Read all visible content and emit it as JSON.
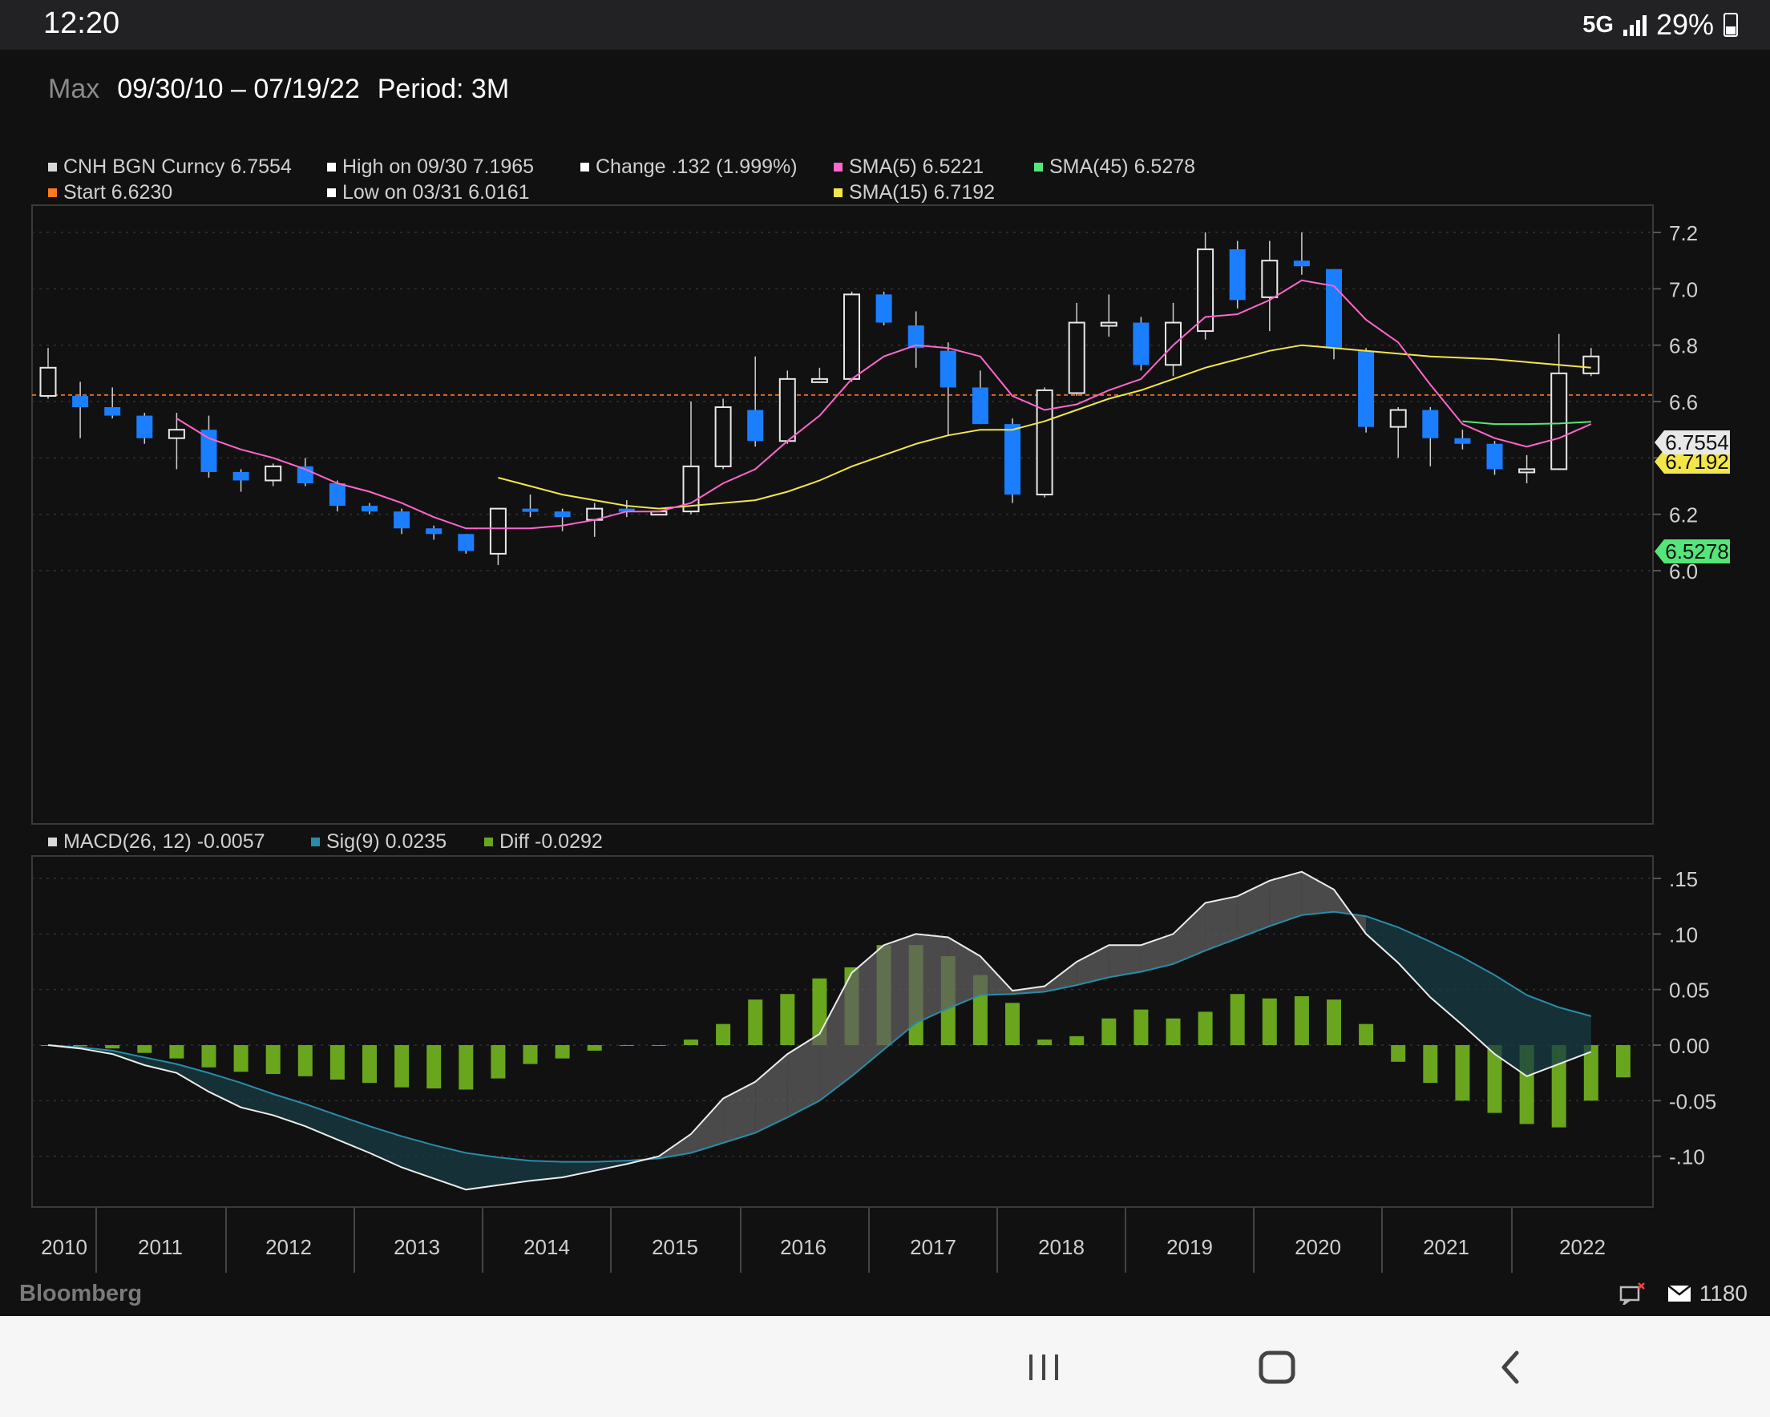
{
  "status_bar": {
    "time": "12:20",
    "network": "5G",
    "battery": "29%"
  },
  "header": {
    "range_label": "Max",
    "date_range": "09/30/10 – 07/19/22",
    "period": "Period: 3M"
  },
  "legend": {
    "main": [
      {
        "label": "CNH BGN Curncy 6.7554",
        "color": "#d8d8d8"
      },
      {
        "label": "Start 6.6230",
        "color": "#ff7a1a"
      },
      {
        "label": "High on 09/30 7.1965",
        "color": "#ffffff"
      },
      {
        "label": "Low on 03/31 6.0161",
        "color": "#ffffff"
      },
      {
        "label": "Change .132 (1.999%)",
        "color": "#ffffff"
      },
      {
        "label": "SMA(5) 6.5221",
        "color": "#ff66cc"
      },
      {
        "label": "SMA(15) 6.7192",
        "color": "#f2e64a"
      },
      {
        "label": "SMA(45) 6.5278",
        "color": "#55e67a"
      }
    ],
    "macd": [
      {
        "label": "MACD(26, 12) -0.0057",
        "color": "#d8d8d8"
      },
      {
        "label": "Sig(9) 0.0235",
        "color": "#2a8ca8"
      },
      {
        "label": "Diff -0.0292",
        "color": "#6aa51e"
      }
    ]
  },
  "price_axis": {
    "ticks": [
      "7.2",
      "7.0",
      "6.8",
      "6.6",
      "6.4",
      "6.2",
      "6.0"
    ],
    "min": 5.98,
    "max": 7.22
  },
  "macd_axis": {
    "ticks": [
      ".15",
      ".10",
      "0.05",
      "0.00",
      "-0.05",
      "-.10"
    ],
    "values": [
      0.15,
      0.1,
      0.05,
      0.0,
      -0.05,
      -0.1
    ]
  },
  "x_axis": {
    "labels": [
      "2010",
      "2011",
      "2012",
      "2013",
      "2014",
      "2015",
      "2016",
      "2017",
      "2018",
      "2019",
      "2020",
      "2021",
      "2022"
    ]
  },
  "price_labels": {
    "last": "6.7554",
    "sma15": "6.7192",
    "sma45": "6.5278"
  },
  "footer": {
    "brand": "Bloomberg",
    "count": "1180"
  },
  "chart_data": {
    "type": "candlestick",
    "title": "CNH BGN Curncy",
    "interval": "3M",
    "start_ref": 6.623,
    "ylim": [
      5.98,
      7.22
    ],
    "candles": [
      {
        "o": 6.62,
        "h": 6.79,
        "l": 6.61,
        "c": 6.72
      },
      {
        "o": 6.62,
        "h": 6.67,
        "l": 6.47,
        "c": 6.58
      },
      {
        "o": 6.58,
        "h": 6.65,
        "l": 6.54,
        "c": 6.55
      },
      {
        "o": 6.55,
        "h": 6.56,
        "l": 6.45,
        "c": 6.47
      },
      {
        "o": 6.47,
        "h": 6.56,
        "l": 6.36,
        "c": 6.5
      },
      {
        "o": 6.5,
        "h": 6.55,
        "l": 6.33,
        "c": 6.35
      },
      {
        "o": 6.35,
        "h": 6.36,
        "l": 6.28,
        "c": 6.32
      },
      {
        "o": 6.32,
        "h": 6.38,
        "l": 6.3,
        "c": 6.37
      },
      {
        "o": 6.37,
        "h": 6.4,
        "l": 6.3,
        "c": 6.31
      },
      {
        "o": 6.31,
        "h": 6.32,
        "l": 6.21,
        "c": 6.23
      },
      {
        "o": 6.23,
        "h": 6.24,
        "l": 6.2,
        "c": 6.21
      },
      {
        "o": 6.21,
        "h": 6.22,
        "l": 6.13,
        "c": 6.15
      },
      {
        "o": 6.15,
        "h": 6.16,
        "l": 6.11,
        "c": 6.13
      },
      {
        "o": 6.13,
        "h": 6.13,
        "l": 6.06,
        "c": 6.07
      },
      {
        "o": 6.06,
        "h": 6.22,
        "l": 6.02,
        "c": 6.22
      },
      {
        "o": 6.22,
        "h": 6.27,
        "l": 6.19,
        "c": 6.21
      },
      {
        "o": 6.21,
        "h": 6.22,
        "l": 6.14,
        "c": 6.19
      },
      {
        "o": 6.18,
        "h": 6.24,
        "l": 6.12,
        "c": 6.22
      },
      {
        "o": 6.22,
        "h": 6.25,
        "l": 6.19,
        "c": 6.21
      },
      {
        "o": 6.21,
        "h": 6.21,
        "l": 6.2,
        "c": 6.21
      },
      {
        "o": 6.21,
        "h": 6.6,
        "l": 6.2,
        "c": 6.37
      },
      {
        "o": 6.37,
        "h": 6.61,
        "l": 6.36,
        "c": 6.58
      },
      {
        "o": 6.57,
        "h": 6.76,
        "l": 6.44,
        "c": 6.46
      },
      {
        "o": 6.46,
        "h": 6.71,
        "l": 6.45,
        "c": 6.68
      },
      {
        "o": 6.68,
        "h": 6.72,
        "l": 6.67,
        "c": 6.68
      },
      {
        "o": 6.68,
        "h": 6.99,
        "l": 6.67,
        "c": 6.98
      },
      {
        "o": 6.98,
        "h": 6.99,
        "l": 6.87,
        "c": 6.88
      },
      {
        "o": 6.87,
        "h": 6.92,
        "l": 6.72,
        "c": 6.79
      },
      {
        "o": 6.78,
        "h": 6.81,
        "l": 6.48,
        "c": 6.65
      },
      {
        "o": 6.65,
        "h": 6.71,
        "l": 6.52,
        "c": 6.52
      },
      {
        "o": 6.52,
        "h": 6.54,
        "l": 6.24,
        "c": 6.27
      },
      {
        "o": 6.27,
        "h": 6.65,
        "l": 6.26,
        "c": 6.64
      },
      {
        "o": 6.63,
        "h": 6.95,
        "l": 6.62,
        "c": 6.88
      },
      {
        "o": 6.88,
        "h": 6.98,
        "l": 6.83,
        "c": 6.88
      },
      {
        "o": 6.88,
        "h": 6.9,
        "l": 6.71,
        "c": 6.73
      },
      {
        "o": 6.73,
        "h": 6.95,
        "l": 6.69,
        "c": 6.88
      },
      {
        "o": 6.85,
        "h": 7.2,
        "l": 6.82,
        "c": 7.14
      },
      {
        "o": 7.14,
        "h": 7.17,
        "l": 6.93,
        "c": 6.96
      },
      {
        "o": 6.97,
        "h": 7.17,
        "l": 6.85,
        "c": 7.1
      },
      {
        "o": 7.1,
        "h": 7.2,
        "l": 7.05,
        "c": 7.08
      },
      {
        "o": 7.07,
        "h": 7.07,
        "l": 6.75,
        "c": 6.79
      },
      {
        "o": 6.78,
        "h": 6.79,
        "l": 6.49,
        "c": 6.51
      },
      {
        "o": 6.51,
        "h": 6.58,
        "l": 6.4,
        "c": 6.57
      },
      {
        "o": 6.57,
        "h": 6.58,
        "l": 6.37,
        "c": 6.47
      },
      {
        "o": 6.47,
        "h": 6.5,
        "l": 6.43,
        "c": 6.45
      },
      {
        "o": 6.45,
        "h": 6.46,
        "l": 6.34,
        "c": 6.36
      },
      {
        "o": 6.36,
        "h": 6.41,
        "l": 6.31,
        "c": 6.36
      },
      {
        "o": 6.36,
        "h": 6.84,
        "l": 6.36,
        "c": 6.7
      },
      {
        "o": 6.7,
        "h": 6.79,
        "l": 6.69,
        "c": 6.76
      }
    ],
    "sma5": [
      null,
      null,
      null,
      null,
      6.54,
      6.47,
      6.43,
      6.4,
      6.36,
      6.31,
      6.28,
      6.24,
      6.19,
      6.15,
      6.15,
      6.15,
      6.16,
      6.18,
      6.21,
      6.21,
      6.24,
      6.31,
      6.36,
      6.46,
      6.55,
      6.68,
      6.76,
      6.8,
      6.79,
      6.76,
      6.62,
      6.57,
      6.59,
      6.64,
      6.68,
      6.8,
      6.9,
      6.91,
      6.96,
      7.03,
      7.01,
      6.89,
      6.81,
      6.66,
      6.52,
      6.47,
      6.44,
      6.47,
      6.52
    ],
    "sma15": [
      null,
      null,
      null,
      null,
      null,
      null,
      null,
      null,
      null,
      null,
      null,
      null,
      null,
      null,
      6.33,
      6.3,
      6.27,
      6.25,
      6.23,
      6.22,
      6.23,
      6.24,
      6.25,
      6.28,
      6.32,
      6.37,
      6.41,
      6.45,
      6.48,
      6.5,
      6.5,
      6.53,
      6.57,
      6.61,
      6.64,
      6.68,
      6.72,
      6.75,
      6.78,
      6.8,
      6.79,
      6.78,
      6.77,
      6.76,
      6.755,
      6.75,
      6.74,
      6.73,
      6.72
    ],
    "sma45": [
      null,
      null,
      null,
      null,
      null,
      null,
      null,
      null,
      null,
      null,
      null,
      null,
      null,
      null,
      null,
      null,
      null,
      null,
      null,
      null,
      null,
      null,
      null,
      null,
      null,
      null,
      null,
      null,
      null,
      null,
      null,
      null,
      null,
      null,
      null,
      null,
      null,
      null,
      null,
      null,
      null,
      null,
      null,
      null,
      6.53,
      6.52,
      6.52,
      6.522,
      6.528
    ],
    "macd": [
      0,
      -0.003,
      -0.008,
      -0.018,
      -0.025,
      -0.042,
      -0.056,
      -0.063,
      -0.073,
      -0.085,
      -0.097,
      -0.11,
      -0.12,
      -0.13,
      -0.126,
      -0.122,
      -0.119,
      -0.113,
      -0.107,
      -0.1,
      -0.08,
      -0.048,
      -0.033,
      -0.008,
      0.01,
      0.065,
      0.09,
      0.1,
      0.097,
      0.08,
      0.049,
      0.053,
      0.075,
      0.09,
      0.09,
      0.1,
      0.128,
      0.134,
      0.148,
      0.156,
      0.14,
      0.1,
      0.074,
      0.043,
      0.018,
      -0.008,
      -0.028,
      -0.017,
      -0.006
    ],
    "signal": [
      0,
      -0.002,
      -0.005,
      -0.011,
      -0.017,
      -0.025,
      -0.034,
      -0.044,
      -0.053,
      -0.063,
      -0.073,
      -0.082,
      -0.09,
      -0.097,
      -0.101,
      -0.104,
      -0.105,
      -0.105,
      -0.104,
      -0.102,
      -0.097,
      -0.088,
      -0.079,
      -0.065,
      -0.05,
      -0.028,
      -0.004,
      0.02,
      0.033,
      0.045,
      0.046,
      0.048,
      0.054,
      0.061,
      0.066,
      0.073,
      0.085,
      0.096,
      0.107,
      0.117,
      0.12,
      0.116,
      0.106,
      0.093,
      0.079,
      0.063,
      0.045,
      0.034,
      0.026
    ],
    "diff": [
      0,
      -0.001,
      -0.003,
      -0.007,
      -0.012,
      -0.02,
      -0.024,
      -0.026,
      -0.028,
      -0.031,
      -0.034,
      -0.038,
      -0.039,
      -0.04,
      -0.03,
      -0.017,
      -0.012,
      -0.005,
      0,
      0,
      0.005,
      0.019,
      0.041,
      0.046,
      0.06,
      0.07,
      0.09,
      0.09,
      0.08,
      0.063,
      0.038,
      0.005,
      0.008,
      0.024,
      0.032,
      0.024,
      0.03,
      0.046,
      0.042,
      0.044,
      0.041,
      0.019,
      -0.015,
      -0.034,
      -0.05,
      -0.061,
      -0.071,
      -0.074,
      -0.05,
      -0.029
    ]
  }
}
